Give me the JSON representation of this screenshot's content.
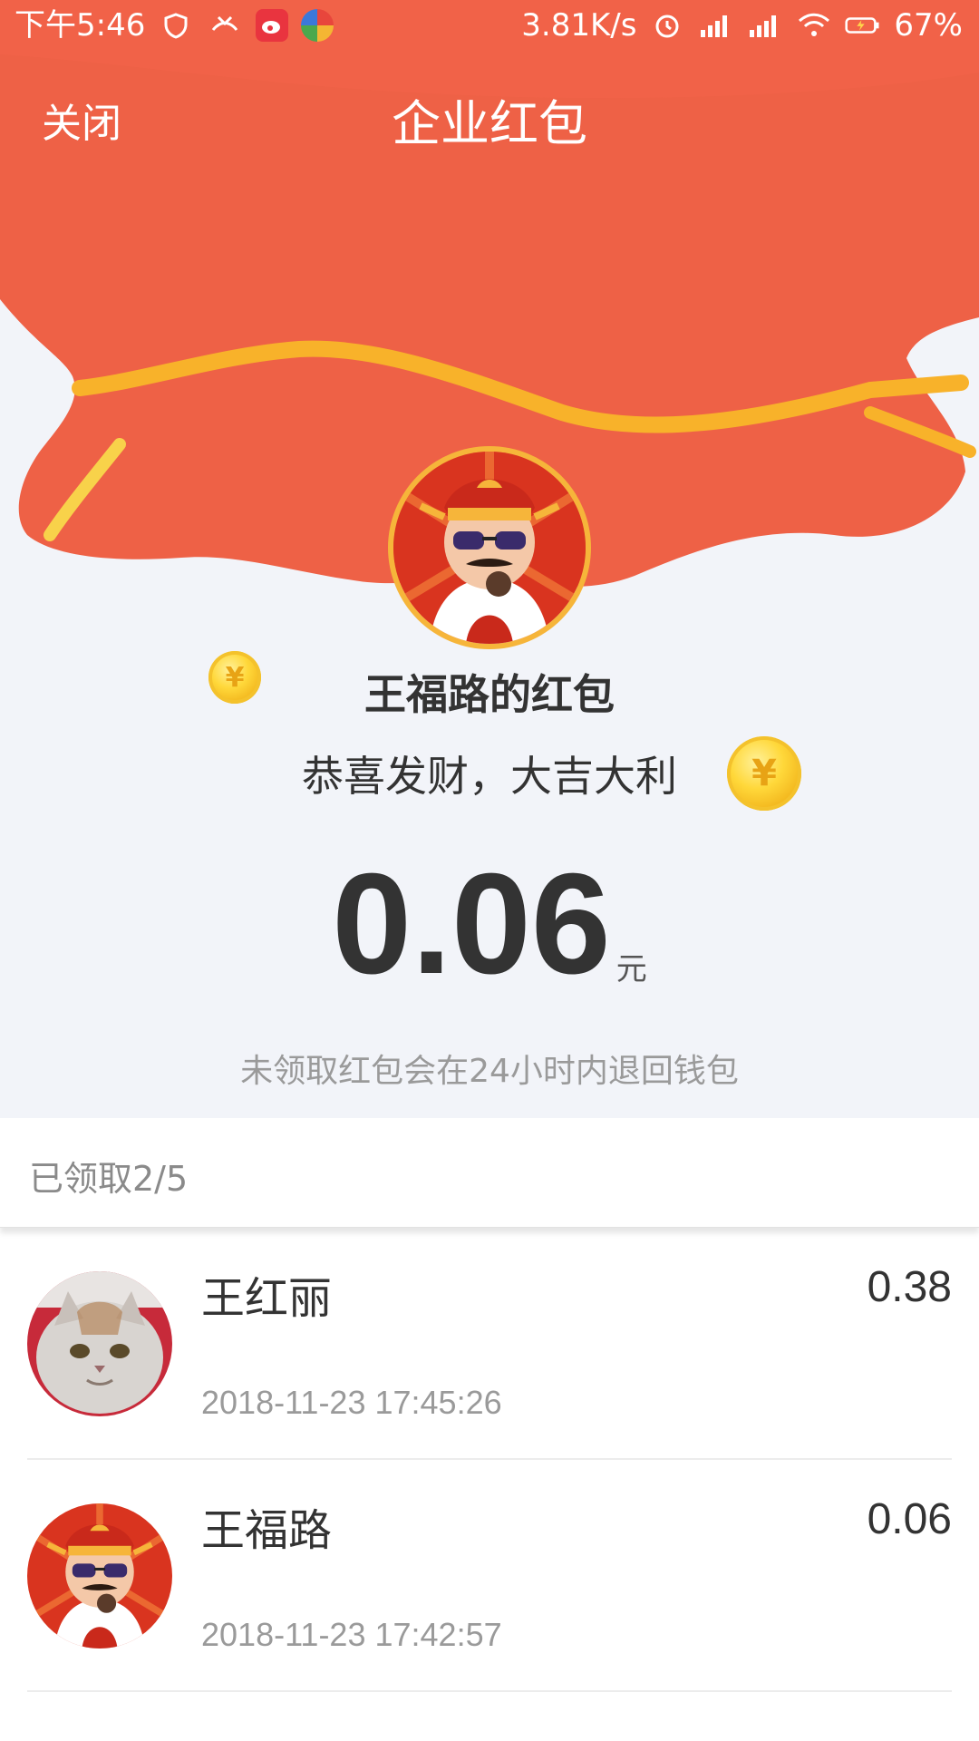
{
  "status_bar": {
    "time": "下午5:46",
    "net_speed": "3.81K/s",
    "battery": "67%"
  },
  "nav": {
    "close_label": "关闭",
    "title": "企业红包"
  },
  "packet": {
    "sender": "王福路的红包",
    "greeting": "恭喜发财，大吉大利",
    "amount": "0.06",
    "unit": "元",
    "notice": "未领取红包会在24小时内退回钱包"
  },
  "claimed": {
    "label": "已领取2/5",
    "items": [
      {
        "name": "王红丽",
        "amount": "0.38",
        "time": "2018-11-23 17:45:26",
        "avatar": "cat-avatar"
      },
      {
        "name": "王福路",
        "amount": "0.06",
        "time": "2018-11-23 17:42:57",
        "avatar": "god-of-wealth-avatar"
      }
    ]
  },
  "colors": {
    "bag_red": "#ee6146",
    "ribbon_gold": "#f8b22a",
    "page_bg": "#f2f4f9",
    "text_dark": "#333333",
    "text_gray": "#9a9a9a"
  }
}
